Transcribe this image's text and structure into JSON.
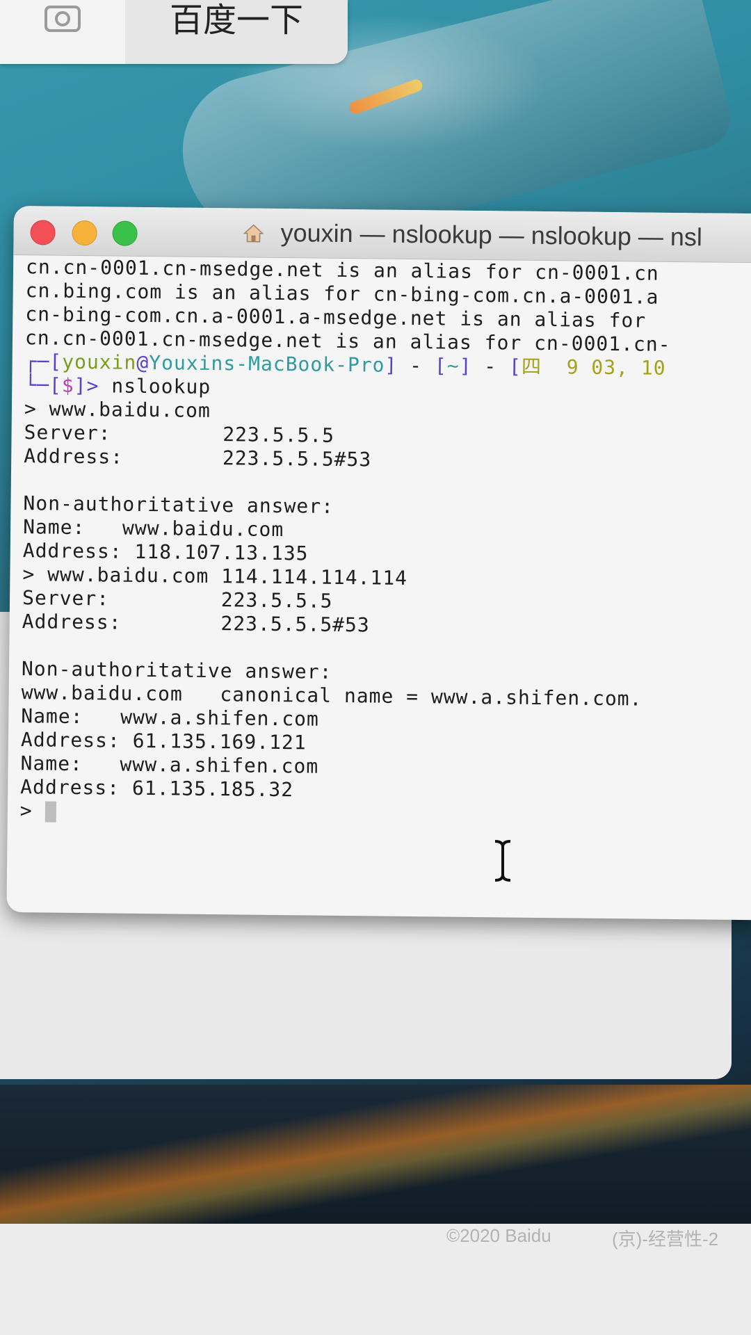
{
  "browser": {
    "search_button": "百度一下",
    "footer_copyright": "©2020 Baidu",
    "footer_license": "(京)-经营性-2"
  },
  "terminal": {
    "title": "youxin — nslookup — nslookup — nsl",
    "lines": [
      "cn.cn-0001.cn-msedge.net is an alias for cn-0001.cn",
      "cn.bing.com is an alias for cn-bing-com.cn.a-0001.a",
      "cn-bing-com.cn.a-0001.a-msedge.net is an alias for",
      "cn.cn-0001.cn-msedge.net is an alias for cn-0001.cn-"
    ],
    "prompt": {
      "corner_top": "┌─",
      "user": "youxin",
      "host": "Youxins-MacBook-Pro",
      "path": "~",
      "date": "四  9 03, 10",
      "corner_bottom": "└─",
      "symbol": "$",
      "command": "nslookup"
    },
    "session": [
      "> www.baidu.com",
      "Server:\t\t223.5.5.5",
      "Address:\t223.5.5.5#53",
      "",
      "Non-authoritative answer:",
      "Name:\twww.baidu.com",
      "Address: 118.107.13.135",
      "> www.baidu.com 114.114.114.114",
      "Server:\t\t223.5.5.5",
      "Address:\t223.5.5.5#53",
      "",
      "Non-authoritative answer:",
      "www.baidu.com\tcanonical name = www.a.shifen.com.",
      "Name:\twww.a.shifen.com",
      "Address: 61.135.169.121",
      "Name:\twww.a.shifen.com",
      "Address: 61.135.185.32",
      ">"
    ]
  }
}
